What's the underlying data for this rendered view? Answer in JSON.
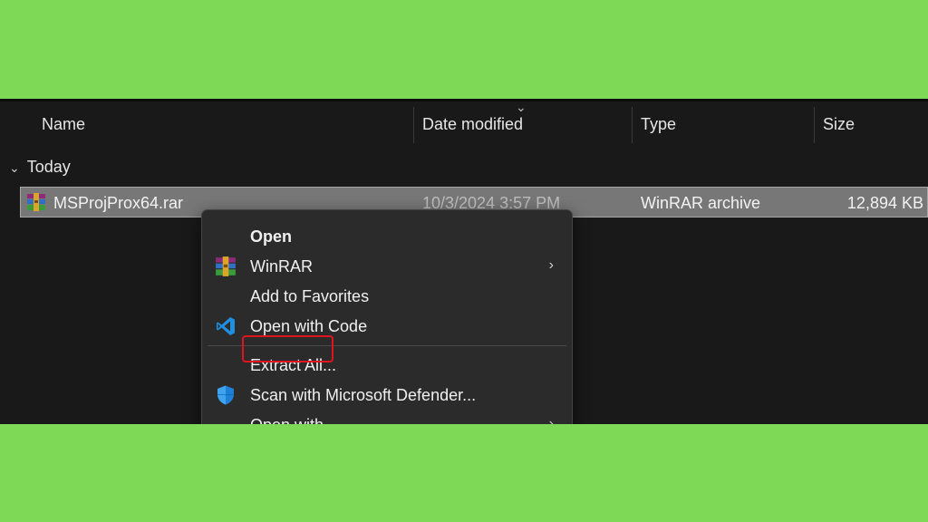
{
  "columns": {
    "name": "Name",
    "date_modified": "Date modified",
    "type": "Type",
    "size": "Size"
  },
  "group": {
    "label": "Today",
    "expanded": true
  },
  "file": {
    "name": "MSProjProx64.rar",
    "date_modified": "10/3/2024 3:57 PM",
    "type": "WinRAR archive",
    "size": "12,894 KB",
    "icon": "winrar-icon"
  },
  "context_menu": {
    "items": [
      {
        "label": "Open",
        "bold": true
      },
      {
        "label": "WinRAR",
        "icon": "winrar-icon",
        "submenu": true
      },
      {
        "label": "Add to Favorites"
      },
      {
        "label": "Open with Code",
        "icon": "vscode-icon"
      },
      {
        "label": "Extract All...",
        "highlighted": true
      },
      {
        "label": "Scan with Microsoft Defender...",
        "icon": "defender-shield-icon"
      },
      {
        "label": "Open with",
        "submenu": true
      }
    ],
    "submenu_glyph": "›"
  },
  "colors": {
    "background": "#7ed957",
    "explorer_bg": "#191919",
    "selected_row": "#777777",
    "menu_bg": "#2b2b2b",
    "highlight_border": "#e0141f"
  }
}
